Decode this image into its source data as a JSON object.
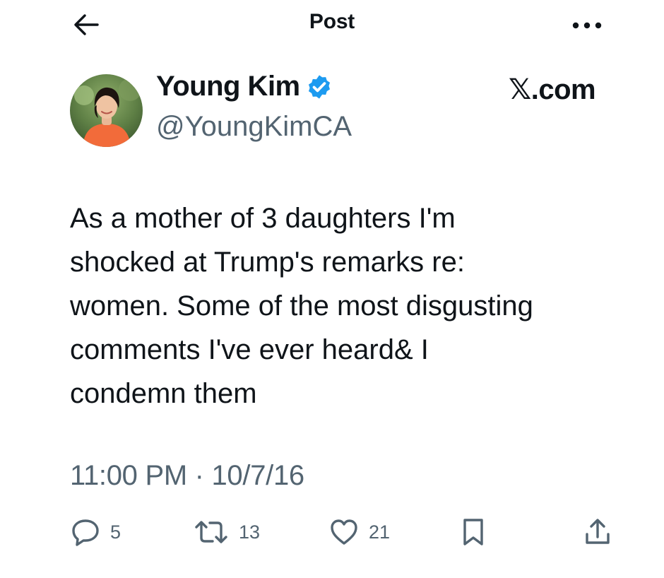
{
  "header": {
    "title": "Post",
    "back_icon": "arrow-left-icon",
    "more_icon": "more-horizontal-icon"
  },
  "author": {
    "name": "Young Kim",
    "handle": "@YoungKimCA",
    "verified": true,
    "verified_color": "#1d9bf0"
  },
  "brand": {
    "label": "𝕏.com"
  },
  "post": {
    "lines": [
      "As a mother of 3 daughters I'm",
      "shocked at Trump's remarks re:",
      "women. Some of the most disgusting",
      "comments I've ever heard& I",
      "condemn them"
    ],
    "timestamp": "11:00 PM · 10/7/16"
  },
  "actions": {
    "reply": {
      "icon": "reply-icon",
      "count": "5"
    },
    "retweet": {
      "icon": "retweet-icon",
      "count": "13"
    },
    "like": {
      "icon": "heart-icon",
      "count": "21"
    },
    "bookmark": {
      "icon": "bookmark-icon"
    },
    "share": {
      "icon": "share-icon"
    }
  },
  "colors": {
    "text_primary": "#0f1419",
    "text_secondary": "#536471",
    "accent": "#1d9bf0"
  }
}
